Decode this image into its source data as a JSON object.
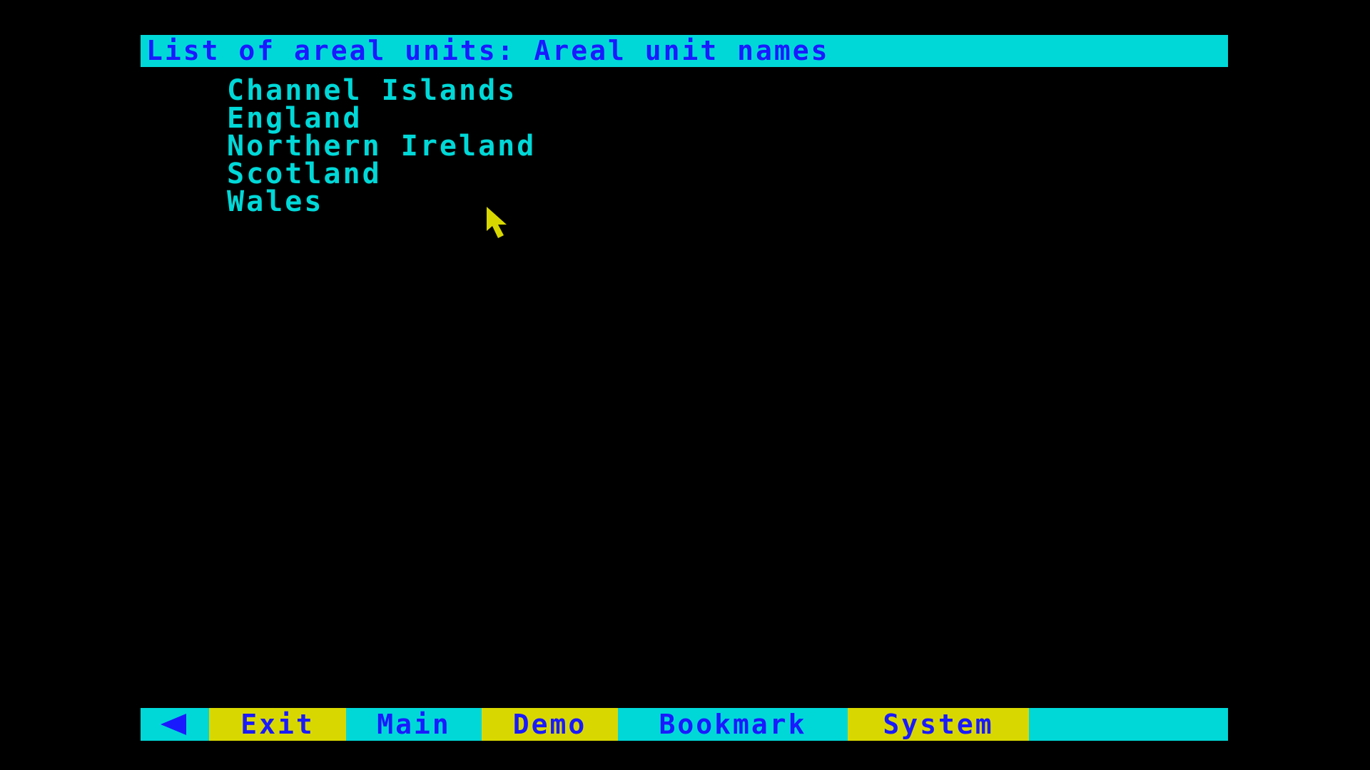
{
  "title": "List of areal units: Areal unit names",
  "units": [
    "Channel Islands",
    "England",
    "Northern Ireland",
    "Scotland",
    "Wales"
  ],
  "menu": {
    "back_icon": "left-arrow-icon",
    "exit": "Exit",
    "main": "Main",
    "demo": "Demo",
    "bookmark": "Bookmark",
    "system": "System"
  },
  "colors": {
    "background": "#000000",
    "cyan": "#00d8d8",
    "blue": "#1a1aff",
    "yellow": "#d8d800"
  }
}
